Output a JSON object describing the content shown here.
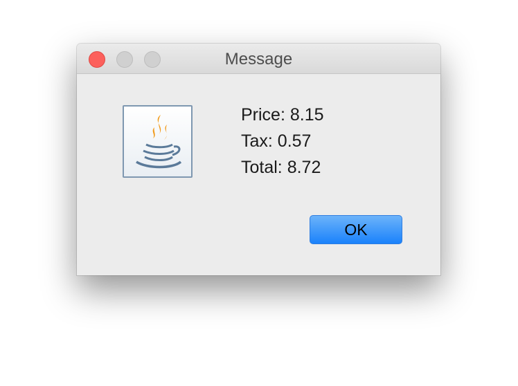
{
  "window": {
    "title": "Message",
    "controls": {
      "close": "close-icon",
      "minimize": "minimize-icon",
      "zoom": "zoom-icon"
    },
    "icon": "java-coffee-cup-icon"
  },
  "message": {
    "lines": [
      "Price: 8.15",
      "Tax: 0.57",
      "Total: 8.72"
    ]
  },
  "buttons": {
    "ok_label": "OK"
  },
  "colors": {
    "close": "#fc605c",
    "accent": "#1a82fb",
    "java_orange": "#f19a1a",
    "java_blue": "#5b7a99"
  }
}
